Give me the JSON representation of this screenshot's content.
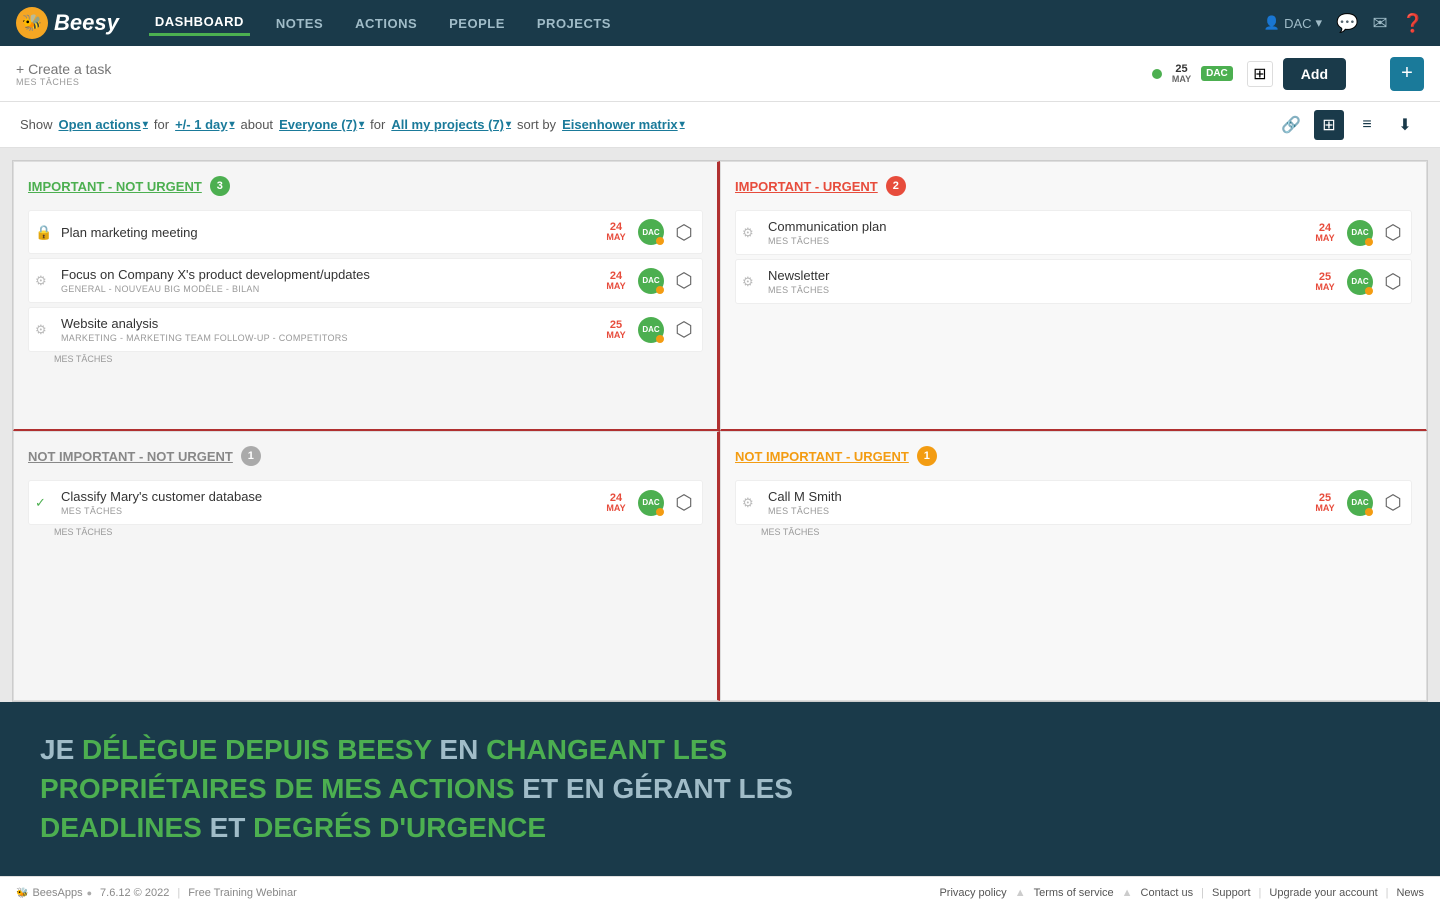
{
  "nav": {
    "logo_text": "Beesy",
    "items": [
      {
        "label": "DASHBOARD",
        "active": true
      },
      {
        "label": "NOTES",
        "active": false
      },
      {
        "label": "ACTIONS",
        "active": false
      },
      {
        "label": "PEOPLE",
        "active": false
      },
      {
        "label": "PROJECTS",
        "active": false
      }
    ],
    "user": "DAC",
    "icons": [
      "chat",
      "mail",
      "help"
    ]
  },
  "toolbar": {
    "create_task_placeholder": "+ Create a task",
    "mes_taches_label": "MES TÂCHES",
    "date_num": "25",
    "date_month": "MAY",
    "user_badge": "DAC",
    "add_label": "Add"
  },
  "filter_bar": {
    "show_label": "Show",
    "open_actions_label": "Open actions",
    "for_label": "for",
    "range_label": "+/- 1 day",
    "about_label": "about",
    "everyone_label": "Everyone (7)",
    "for2_label": "for",
    "projects_label": "All my projects (7)",
    "sort_label": "sort by",
    "matrix_label": "Eisenhower matrix"
  },
  "quadrants": {
    "tl": {
      "title": "IMPORTANT - NOT URGENT",
      "count": 3,
      "tasks": [
        {
          "name": "Plan marketing meeting",
          "sub": "",
          "date_num": "24",
          "date_month": "MAY",
          "avatar": "DAC",
          "checked": false
        },
        {
          "name": "Focus on Company X's product development/updates",
          "sub": "GENERAL - NOUVEAU BIG MODÈLE - BILAN",
          "date_num": "24",
          "date_month": "MAY",
          "avatar": "DAC",
          "checked": false
        },
        {
          "name": "Website analysis",
          "sub": "MARKETING - MARKETING TEAM FOLLOW-UP - COMPETITORS",
          "date_num": "25",
          "date_month": "MAY",
          "avatar": "DAC",
          "checked": false
        }
      ],
      "task_label": "MES TÂCHES"
    },
    "tr": {
      "title": "IMPORTANT - URGENT",
      "count": 2,
      "tasks": [
        {
          "name": "Communication plan",
          "sub": "MES TÂCHES",
          "date_num": "24",
          "date_month": "MAY",
          "avatar": "DAC",
          "checked": false
        },
        {
          "name": "Newsletter",
          "sub": "MES TÂCHES",
          "date_num": "25",
          "date_month": "MAY",
          "avatar": "DAC",
          "checked": false
        }
      ]
    },
    "bl": {
      "title": "NOT IMPORTANT - NOT URGENT",
      "count": 1,
      "tasks": [
        {
          "name": "Classify Mary's customer database",
          "sub": "MES TÂCHES",
          "date_num": "24",
          "date_month": "MAY",
          "avatar": "DAC",
          "checked": false
        }
      ]
    },
    "br": {
      "title": "NOT IMPORTANT - URGENT",
      "count": 1,
      "tasks": [
        {
          "name": "Call M Smith",
          "sub": "MES TÂCHES",
          "date_num": "25",
          "date_month": "MAY",
          "avatar": "DAC",
          "checked": false
        }
      ]
    }
  },
  "promo": {
    "line1_normal": "JE ",
    "line1_highlight": "DÉLÈGUE DEPUIS BEESY",
    "line1_normal2": " EN ",
    "line1_highlight2": "CHANGEANT LES",
    "line2_highlight": "PROPRIÉTAIRES DE MES ACTIONS",
    "line2_normal": " ET EN GÉRANT LES",
    "line3_highlight": "DEADLINES",
    "line3_normal": " ET ",
    "line3_highlight2": "DEGRÉS D'URGENCE"
  },
  "footer": {
    "logo": "BeesApps",
    "version": "7.6.12 © 2022",
    "webinar": "Free Training Webinar",
    "links": [
      {
        "label": "Privacy policy"
      },
      {
        "label": "Terms of service"
      },
      {
        "label": "Contact us"
      },
      {
        "label": "Support"
      },
      {
        "label": "Upgrade your account"
      },
      {
        "label": "News"
      }
    ]
  }
}
